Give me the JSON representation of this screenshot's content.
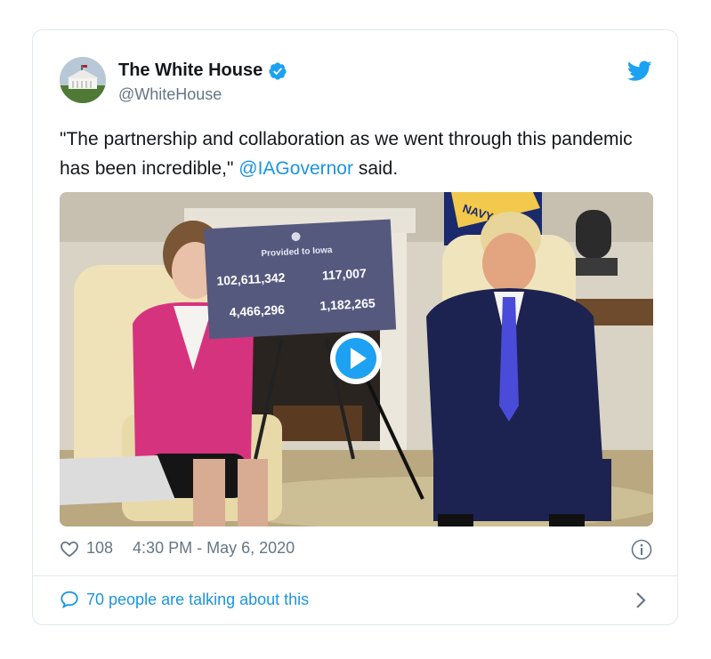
{
  "tweet": {
    "author_name": "The White House",
    "author_handle": "@WhiteHouse",
    "text_before_mention": "\"The partnership and collaboration as we went through this pandemic has been incredible,\"",
    "mention": "@IAGovernor",
    "text_after_mention": "said.",
    "likes": "108",
    "timestamp": "4:30 PM - May 6, 2020",
    "talking_label": "70 people are talking about this"
  },
  "media": {
    "sign_title": "Provided to Iowa",
    "sign_values": [
      "102,611,342",
      "117,007",
      "4,466,296",
      "1,182,265"
    ],
    "flag_text": "NAVY"
  },
  "icons": {
    "verified": "verified-badge-icon",
    "bird": "twitter-bird-icon",
    "play": "play-icon",
    "heart": "heart-icon",
    "info": "info-icon",
    "bubble": "speech-bubble-icon",
    "chevron": "chevron-right-icon"
  },
  "colors": {
    "link_blue": "#1b95e0",
    "text_dark": "#14171a",
    "text_gray": "#657786",
    "border": "#e1e8ed"
  }
}
